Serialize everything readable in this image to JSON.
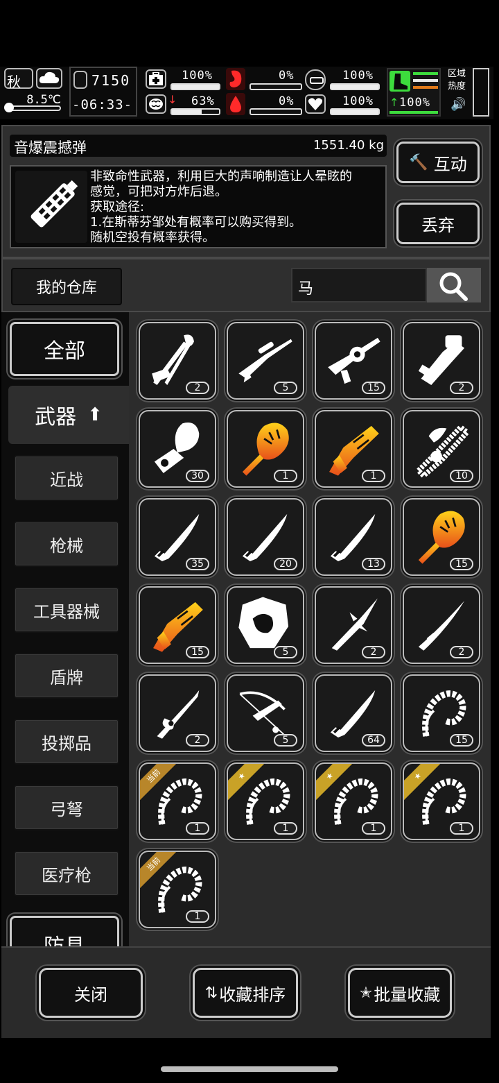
{
  "status": {
    "season": "秋",
    "temperature": "8.5℃",
    "day": "7150",
    "time": "-06:33-",
    "health_pct": "100%",
    "health_level": 1.0,
    "mental_pct": "63%",
    "mental_level": 0.63,
    "hunger_pct": "0%",
    "hunger_level": 0.0,
    "bleed_pct": "0%",
    "bleed_level": 0.0,
    "armor_pct": "100%",
    "armor_level": 1.0,
    "heart_pct": "100%",
    "heart_level": 1.0,
    "stamina_pct": "100%",
    "zone_heat_label": "区域热度"
  },
  "item": {
    "name": "音爆震撼弹",
    "weight": "1551.40 kg",
    "description_lines": [
      "非致命性武器，利用巨大的声响制造让人晕眩的",
      "感觉，可把对方炸后退。",
      "获取途径:",
      "1.在斯蒂芬邹处有概率可以购买得到。",
      "随机空投有概率获得。"
    ],
    "interact_label": "互动",
    "discard_label": "丢弃"
  },
  "warehouse": {
    "label": "我的仓库",
    "search_value": "马"
  },
  "categories": {
    "all": "全部",
    "weapons": "武器",
    "melee": "近战",
    "guns": "枪械",
    "tools": "工具器械",
    "shields": "盾牌",
    "throwables": "投掷品",
    "bows": "弓弩",
    "medical_guns": "医疗枪",
    "armor": "防具"
  },
  "items": [
    {
      "icon": "horse-weapon-rack-icon",
      "count": "2"
    },
    {
      "icon": "sniper-rifle-icon",
      "count": "5"
    },
    {
      "icon": "heavy-gun-icon",
      "count": "15"
    },
    {
      "icon": "gauntlet-cannon-icon",
      "count": "2"
    },
    {
      "icon": "horse-arm-cannon-icon",
      "count": "30"
    },
    {
      "icon": "golden-horse-mace-icon",
      "count": "1",
      "gold": true
    },
    {
      "icon": "golden-horse-blaster-icon",
      "count": "1",
      "gold": true
    },
    {
      "icon": "horse-chainsaw-icon",
      "count": "10"
    },
    {
      "icon": "knife-icon",
      "count": "35"
    },
    {
      "icon": "knife-icon",
      "count": "20"
    },
    {
      "icon": "knife-icon",
      "count": "13"
    },
    {
      "icon": "golden-horse-mace-icon",
      "count": "15",
      "gold": true
    },
    {
      "icon": "golden-horse-blaster-icon",
      "count": "15",
      "gold": true
    },
    {
      "icon": "horse-shield-icon",
      "count": "5"
    },
    {
      "icon": "spear-icon",
      "count": "2"
    },
    {
      "icon": "katana-icon",
      "count": "2"
    },
    {
      "icon": "ornate-sword-icon",
      "count": "2"
    },
    {
      "icon": "crossbow-icon",
      "count": "5"
    },
    {
      "icon": "knife-icon",
      "count": "64"
    },
    {
      "icon": "bone-whip-icon",
      "count": "15"
    },
    {
      "icon": "bone-whip-icon",
      "count": "1",
      "ribbon": "当前"
    },
    {
      "icon": "bone-whip-icon",
      "count": "1",
      "ribbon": "★"
    },
    {
      "icon": "bone-whip-icon",
      "count": "1",
      "ribbon": "★"
    },
    {
      "icon": "bone-whip-icon",
      "count": "1",
      "ribbon": "★"
    },
    {
      "icon": "bone-whip-icon",
      "count": "1",
      "ribbon": "当前"
    }
  ],
  "footer": {
    "close": "关闭",
    "sort_favorites": "收藏排序",
    "batch_favorite": "批量收藏"
  },
  "colors": {
    "gold_top": "#ffd21a",
    "gold_bottom": "#e8501a",
    "ribbon_current": "#b8862a",
    "ribbon_star": "#c9a227",
    "health_green": "#3ddc3d"
  }
}
